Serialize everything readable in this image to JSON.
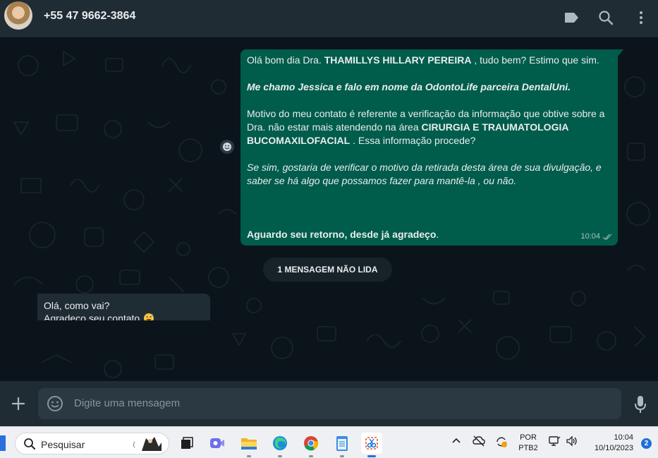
{
  "header": {
    "contact_name": "+55 47 9662-3864",
    "icons": [
      "label-icon",
      "search-icon",
      "more-vertical-icon"
    ]
  },
  "messages": {
    "outgoing": {
      "line1_pre": "Olá bom dia Dra. ",
      "line1_bold": "THAMILLYS HILLARY PEREIRA",
      "line1_post": " , tudo bem? Estimo que sim.",
      "intro": "Me chamo Jessica e falo em nome da OdontoLife parceira DentalUni.",
      "motive_pre": "Motivo do meu contato é referente a verificação da informação que obtive sobre a Dra. não estar mais atendendo na área ",
      "motive_bold": "CIRURGIA E TRAUMATOLOGIA BUCOMAXILOFACIAL",
      "motive_post": " . Essa informação procede?",
      "question": "Se sim, gostaria de verificar o motivo da retirada desta área de sua divulgação, e saber se há algo que possamos fazer para mantê-la , ou não.",
      "closing_bold": "Aguardo seu retorno, desde já agradeço",
      "closing_post": ".",
      "time": "10:04",
      "status": "read"
    },
    "unread_label": "1 MENSAGEM NÃO LIDA",
    "incoming": {
      "line1": "Olá, como vai?",
      "line2": "Agradeço seu contato"
    }
  },
  "composer": {
    "placeholder": "Digite uma mensagem"
  },
  "taskbar": {
    "search_label": "Pesquisar",
    "apps": [
      "task-view-icon",
      "teams-icon",
      "file-explorer-icon",
      "edge-icon",
      "chrome-icon",
      "notepad-icon",
      "snipping-tool-icon"
    ],
    "lang_line1": "POR",
    "lang_line2": "PTB2",
    "time": "10:04",
    "date": "10/10/2023",
    "notification_count": "2"
  },
  "colors": {
    "outgoing_bubble": "#005c4b",
    "incoming_bubble": "#202c33",
    "chat_background": "#0b141a",
    "header": "#202c33"
  }
}
